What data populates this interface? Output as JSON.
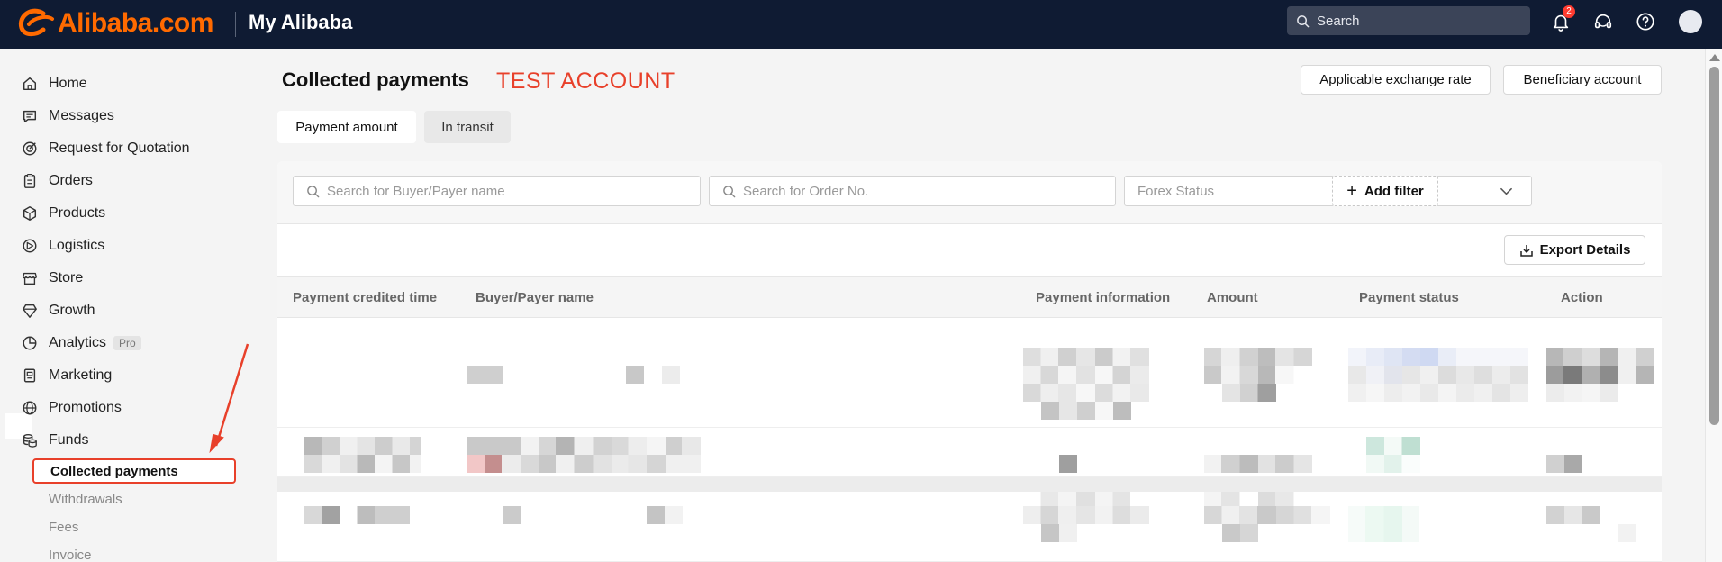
{
  "colors": {
    "brand": "#ff6a00",
    "topbar": "#0f1b33",
    "annotation": "#e8402a"
  },
  "header": {
    "logo_text": "Alibaba.com",
    "title": "My Alibaba",
    "search_placeholder": "Search",
    "notification_count": "2",
    "icons": [
      "bell-icon",
      "headset-icon",
      "help-icon"
    ]
  },
  "sidebar": {
    "items": [
      {
        "label": "Home",
        "icon": "home-icon"
      },
      {
        "label": "Messages",
        "icon": "messages-icon"
      },
      {
        "label": "Request for Quotation",
        "icon": "target-icon"
      },
      {
        "label": "Orders",
        "icon": "clipboard-icon"
      },
      {
        "label": "Products",
        "icon": "box-icon"
      },
      {
        "label": "Logistics",
        "icon": "truck-icon"
      },
      {
        "label": "Store",
        "icon": "store-icon"
      },
      {
        "label": "Growth",
        "icon": "diamond-icon"
      },
      {
        "label": "Analytics",
        "icon": "pie-chart-icon",
        "tag": "Pro"
      },
      {
        "label": "Marketing",
        "icon": "marketing-icon"
      },
      {
        "label": "Promotions",
        "icon": "globe-icon"
      },
      {
        "label": "Funds",
        "icon": "coins-icon"
      }
    ],
    "funds_sub": [
      {
        "label": "Collected payments",
        "active": true
      },
      {
        "label": "Withdrawals"
      },
      {
        "label": "Fees"
      },
      {
        "label": "Invoice"
      }
    ]
  },
  "main": {
    "title": "Collected payments",
    "test_label": "TEST ACCOUNT",
    "buttons": {
      "exchange_rate": "Applicable exchange rate",
      "beneficiary": "Beneficiary account"
    },
    "tabs": [
      {
        "label": "Payment amount",
        "active": true
      },
      {
        "label": "In transit"
      }
    ],
    "filters": {
      "buyer_placeholder": "Search for Buyer/Payer name",
      "order_placeholder": "Search for Order No.",
      "forex_placeholder": "Forex Status",
      "add_filter": "Add filter"
    },
    "export_label": "Export Details",
    "columns": [
      "Payment credited time",
      "Buyer/Payer name",
      "Payment information",
      "Amount",
      "Payment status",
      "Action"
    ]
  }
}
